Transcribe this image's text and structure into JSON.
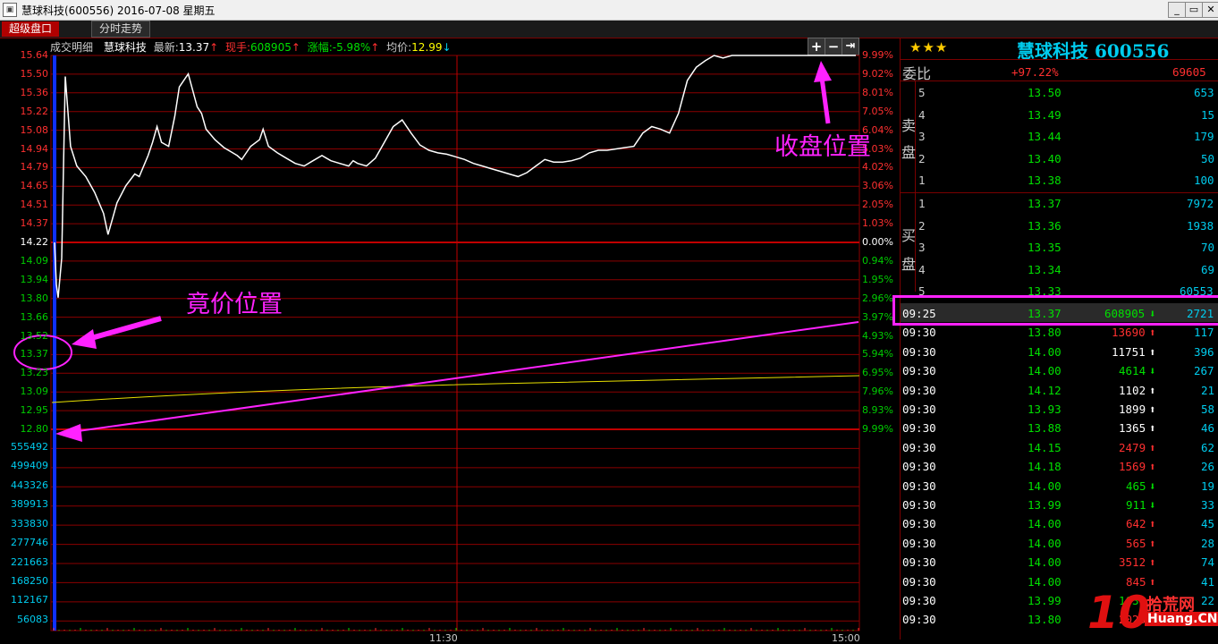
{
  "window": {
    "title": "慧球科技(600556) 2016-07-08 星期五",
    "min": "_",
    "max": "▭",
    "close": "✕"
  },
  "tabs": [
    {
      "label": "超级盘口",
      "active": true
    },
    {
      "label": "分时走势",
      "active": false
    }
  ],
  "infobar": {
    "mode": "成交明细",
    "name": "慧球科技",
    "latest_label": "最新:",
    "latest": "13.37",
    "vol_label": "现手:",
    "vol": "608905",
    "chg_label": "涨幅:",
    "chg": "-5.98%",
    "avg_label": "均价:",
    "avg": "12.99"
  },
  "zoom": {
    "plus": "+",
    "minus": "−",
    "end": "⇥"
  },
  "price_axis": [
    "15.64",
    "15.50",
    "15.36",
    "15.22",
    "15.08",
    "14.94",
    "14.79",
    "14.65",
    "14.51",
    "14.37",
    "14.22",
    "14.09",
    "13.94",
    "13.80",
    "13.66",
    "13.52",
    "13.37",
    "13.23",
    "13.09",
    "12.95",
    "12.80"
  ],
  "pct_axis": [
    "9.99%",
    "9.02%",
    "8.01%",
    "7.05%",
    "6.04%",
    "5.03%",
    "4.02%",
    "3.06%",
    "2.05%",
    "1.03%",
    "0.00%",
    "0.94%",
    "1.95%",
    "2.96%",
    "3.97%",
    "4.93%",
    "5.94%",
    "6.95%",
    "7.96%",
    "8.93%",
    "9.99%"
  ],
  "vol_axis": [
    "555492",
    "499409",
    "443326",
    "389913",
    "333830",
    "277746",
    "221663",
    "168250",
    "112167",
    "56083"
  ],
  "time_axis": [
    "11:30",
    "15:00"
  ],
  "annotations": {
    "auction": "竟价位置",
    "close": "收盘位置"
  },
  "colors": {
    "up": "#ff3030",
    "down": "#00e000",
    "axis_red": "#ff3030",
    "axis_green": "#00cc00",
    "grid": "#8b0000",
    "magenta": "#ff22ff",
    "cyan": "#00ccee"
  },
  "quote": {
    "stars": "★★★",
    "title": "慧球科技 600556",
    "weibi_label": "委比",
    "weibi": "+97.22%",
    "weicha": "69605",
    "sell_label": [
      "卖",
      "盘"
    ],
    "buy_label": [
      "买",
      "盘"
    ],
    "sell": [
      {
        "level": "5",
        "price": "13.50",
        "vol": "653"
      },
      {
        "level": "4",
        "price": "13.49",
        "vol": "15"
      },
      {
        "level": "3",
        "price": "13.44",
        "vol": "179"
      },
      {
        "level": "2",
        "price": "13.40",
        "vol": "50"
      },
      {
        "level": "1",
        "price": "13.38",
        "vol": "100"
      }
    ],
    "buy": [
      {
        "level": "1",
        "price": "13.37",
        "vol": "7972"
      },
      {
        "level": "2",
        "price": "13.36",
        "vol": "1938"
      },
      {
        "level": "3",
        "price": "13.35",
        "vol": "70"
      },
      {
        "level": "4",
        "price": "13.34",
        "vol": "69"
      },
      {
        "level": "5",
        "price": "13.33",
        "vol": "60553"
      }
    ]
  },
  "ticks": [
    {
      "time": "09:25",
      "price": "13.37",
      "vol": "608905",
      "dir": "down",
      "num": "2721",
      "pcolor": "#00e000",
      "vcolor": "#00e000"
    },
    {
      "time": "09:30",
      "price": "13.80",
      "vol": "13690",
      "dir": "up",
      "num": "117",
      "pcolor": "#00e000",
      "vcolor": "#ff3030"
    },
    {
      "time": "09:30",
      "price": "14.00",
      "vol": "11751",
      "dir": "up",
      "num": "396",
      "pcolor": "#00e000",
      "vcolor": "#ffffff"
    },
    {
      "time": "09:30",
      "price": "14.00",
      "vol": "4614",
      "dir": "down",
      "num": "267",
      "pcolor": "#00e000",
      "vcolor": "#00e000"
    },
    {
      "time": "09:30",
      "price": "14.12",
      "vol": "1102",
      "dir": "up",
      "num": "21",
      "pcolor": "#00e000",
      "vcolor": "#ffffff"
    },
    {
      "time": "09:30",
      "price": "13.93",
      "vol": "1899",
      "dir": "up",
      "num": "58",
      "pcolor": "#00e000",
      "vcolor": "#ffffff"
    },
    {
      "time": "09:30",
      "price": "13.88",
      "vol": "1365",
      "dir": "up",
      "num": "46",
      "pcolor": "#00e000",
      "vcolor": "#ffffff"
    },
    {
      "time": "09:30",
      "price": "14.15",
      "vol": "2479",
      "dir": "up",
      "num": "62",
      "pcolor": "#00e000",
      "vcolor": "#ff3030"
    },
    {
      "time": "09:30",
      "price": "14.18",
      "vol": "1569",
      "dir": "up",
      "num": "26",
      "pcolor": "#00e000",
      "vcolor": "#ff3030"
    },
    {
      "time": "09:30",
      "price": "14.00",
      "vol": "465",
      "dir": "down",
      "num": "19",
      "pcolor": "#00e000",
      "vcolor": "#00e000"
    },
    {
      "time": "09:30",
      "price": "13.99",
      "vol": "911",
      "dir": "down",
      "num": "33",
      "pcolor": "#00e000",
      "vcolor": "#00e000"
    },
    {
      "time": "09:30",
      "price": "14.00",
      "vol": "642",
      "dir": "up",
      "num": "45",
      "pcolor": "#00e000",
      "vcolor": "#ff3030"
    },
    {
      "time": "09:30",
      "price": "14.00",
      "vol": "565",
      "dir": "up",
      "num": "28",
      "pcolor": "#00e000",
      "vcolor": "#ff3030"
    },
    {
      "time": "09:30",
      "price": "14.00",
      "vol": "3512",
      "dir": "up",
      "num": "74",
      "pcolor": "#00e000",
      "vcolor": "#ff3030"
    },
    {
      "time": "09:30",
      "price": "14.00",
      "vol": "845",
      "dir": "up",
      "num": "41",
      "pcolor": "#00e000",
      "vcolor": "#ff3030"
    },
    {
      "time": "09:30",
      "price": "13.99",
      "vol": "1639",
      "dir": "up",
      "num": "22",
      "pcolor": "#00e000",
      "vcolor": "#00e000"
    },
    {
      "time": "09:30",
      "price": "13.80",
      "vol": "2028",
      "dir": "up",
      "num": "111",
      "pcolor": "#00e000",
      "vcolor": "#ff3030"
    }
  ],
  "watermark": {
    "num": "10",
    "cn": "拾荒网",
    "en": "Huang.CN"
  },
  "chart_data": {
    "type": "line",
    "title": "",
    "xlabel": "",
    "ylabel": "",
    "ylim": [
      12.8,
      15.64
    ],
    "prev_close": 14.22,
    "x_ticks": [
      "11:30",
      "15:00"
    ],
    "series": [
      {
        "x": [
          0,
          2,
          4,
          8,
          12,
          18,
          25,
          35,
          45,
          55,
          60,
          70,
          80,
          90,
          95,
          100,
          105,
          110,
          115,
          120,
          128,
          135,
          140,
          150,
          160,
          165,
          170,
          180,
          190,
          200,
          205,
          210,
          220,
          230,
          234,
          240,
          250,
          260,
          270,
          280,
          290,
          300,
          305,
          310,
          320,
          330,
          335,
          340,
          350,
          360,
          370,
          380,
          390,
          400,
          410,
          415,
          420,
          430,
          440,
          450,
          460,
          470,
          480,
          490,
          500,
          510,
          520,
          530,
          540,
          550,
          560,
          570,
          580,
          590,
          600,
          610,
          620,
          630,
          640,
          650,
          660,
          670,
          680,
          690,
          700,
          710,
          720,
          730,
          740,
          750,
          760,
          770,
          780,
          790,
          800,
          810,
          820,
          830,
          840,
          850,
          860,
          870,
          880,
          890,
          899
        ],
        "values": [
          14.22,
          13.9,
          13.8,
          14.1,
          15.48,
          14.95,
          14.8,
          14.72,
          14.6,
          14.44,
          14.28,
          14.52,
          14.65,
          14.74,
          14.72,
          14.8,
          14.88,
          14.98,
          15.1,
          14.98,
          14.95,
          15.18,
          15.4,
          15.5,
          15.25,
          15.2,
          15.08,
          15.0,
          14.94,
          14.9,
          14.88,
          14.85,
          14.95,
          15.0,
          15.08,
          14.95,
          14.9,
          14.86,
          14.82,
          14.8,
          14.84,
          14.88,
          14.86,
          14.84,
          14.82,
          14.8,
          14.84,
          14.82,
          14.8,
          14.86,
          14.98,
          15.1,
          15.15,
          15.05,
          14.96,
          14.94,
          14.92,
          14.9,
          14.89,
          14.87,
          14.85,
          14.82,
          14.8,
          14.78,
          14.76,
          14.74,
          14.72,
          14.75,
          14.8,
          14.85,
          14.83,
          14.83,
          14.84,
          14.86,
          14.9,
          14.92,
          14.92,
          14.93,
          14.94,
          14.95,
          15.05,
          15.1,
          15.08,
          15.05,
          15.2,
          15.45,
          15.55,
          15.6,
          15.64,
          15.62,
          15.64,
          15.64,
          15.64,
          15.64,
          15.64,
          15.64,
          15.64,
          15.64,
          15.64,
          15.64,
          15.64,
          15.64,
          15.64,
          15.64,
          15.64
        ],
        "color": "#ffffff"
      }
    ]
  }
}
